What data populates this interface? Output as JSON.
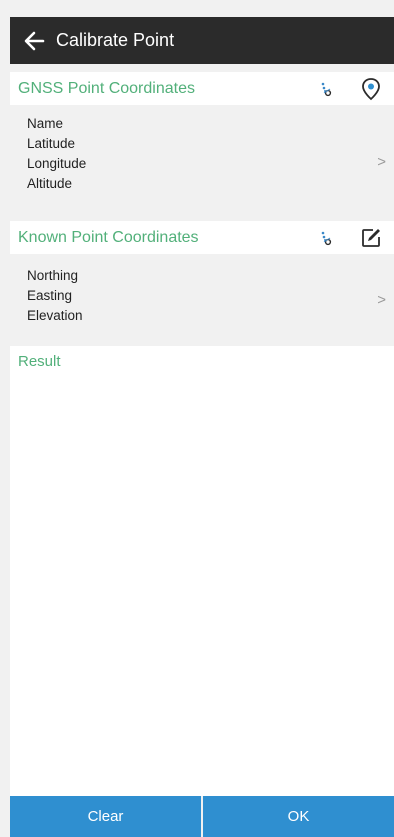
{
  "header": {
    "title": "Calibrate Point"
  },
  "gnss_section": {
    "title": "GNSS Point Coordinates",
    "fields": [
      "Name",
      "Latitude",
      "Longitude",
      "Altitude"
    ],
    "chevron": ">"
  },
  "known_section": {
    "title": "Known Point Coordinates",
    "fields": [
      "Northing",
      "Easting",
      "Elevation"
    ],
    "chevron": ">"
  },
  "result": {
    "title": "Result"
  },
  "buttons": {
    "clear": "Clear",
    "ok": "OK"
  },
  "icons": {
    "back": "back-arrow-icon",
    "survey_point": "survey-point-icon",
    "location_pin": "location-pin-icon",
    "edit": "edit-icon"
  },
  "colors": {
    "topbar_bg": "#2b2b2b",
    "section_title": "#52b07a",
    "button_bg": "#2f8fd0",
    "background": "#f1f1f1"
  }
}
